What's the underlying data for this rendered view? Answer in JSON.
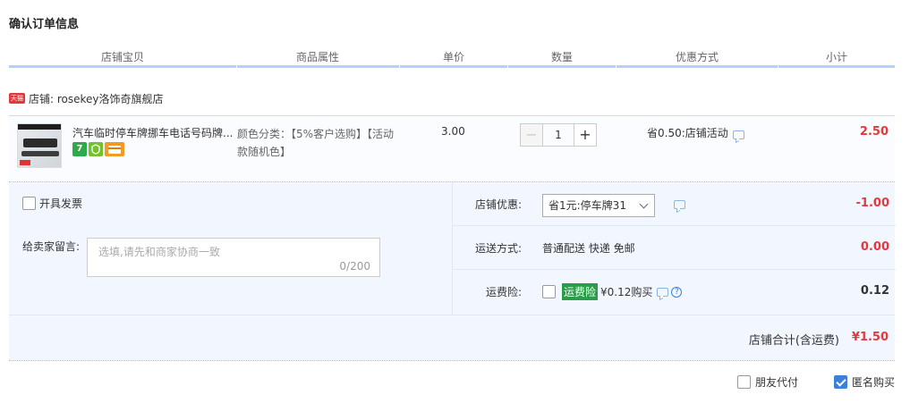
{
  "title": "确认订单信息",
  "columns": [
    "店铺宝贝",
    "商品属性",
    "单价",
    "数量",
    "优惠方式",
    "小计"
  ],
  "shop": {
    "badge": "天猫",
    "label": "店铺: rosekey洛饰奇旗舰店"
  },
  "item": {
    "title": "汽车临时停车牌挪车电话号码牌...",
    "icon_7": "7",
    "attr": "颜色分类：【5%客户选购】【活动款随机色】",
    "price": "3.00",
    "quantity": "1",
    "minus": "−",
    "plus": "+",
    "discount": "省0.50:店铺活动",
    "subtotal": "2.50",
    "icons": [
      "seven-day-return-icon",
      "shield-icon",
      "credit-card-icon"
    ]
  },
  "invoice_label": "开具发票",
  "message": {
    "label": "给卖家留言:",
    "placeholder": "选填,请先和商家协商一致",
    "counter": "0/200"
  },
  "store_discount": {
    "label": "店铺优惠:",
    "selected": "省1元:停车牌31",
    "amount": "-1.00"
  },
  "shipping": {
    "label": "运送方式:",
    "value": "普通配送 快递 免邮",
    "amount": "0.00"
  },
  "insurance": {
    "label": "运费险:",
    "tag": "运费险",
    "text": "¥0.12购买",
    "help": "?",
    "amount": "0.12"
  },
  "total": {
    "label": "店铺合计(含运费)",
    "amount": "¥1.50"
  },
  "options": {
    "friend_pay": "朋友代付",
    "anonymous": "匿名购买",
    "friend_pay_checked": false,
    "anonymous_checked": true
  },
  "colors": {
    "accent_red": "#e4393c",
    "header_rule": "#b2d1ff",
    "panel_bg": "#f2f7ff",
    "checkbox_blue": "#3b80dc",
    "insurance_green": "#2a9d49"
  }
}
